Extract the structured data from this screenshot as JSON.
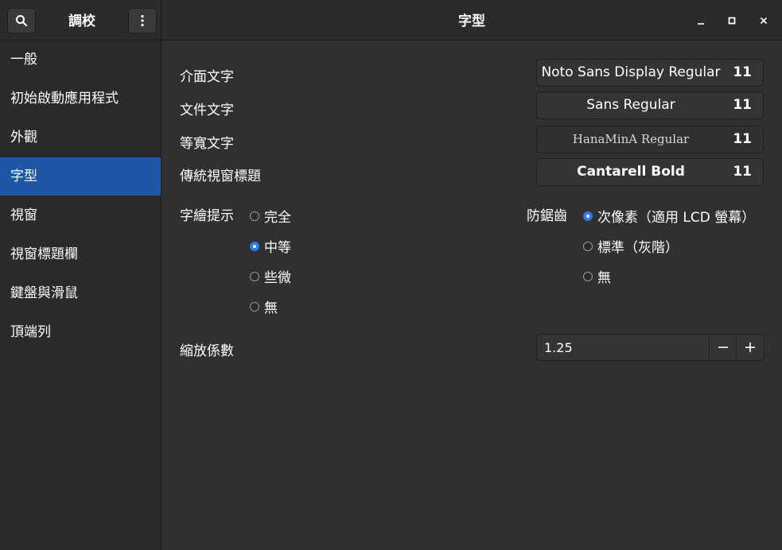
{
  "sidebar_header": {
    "title": "調校"
  },
  "header": {
    "title": "字型"
  },
  "sidebar": {
    "items": [
      {
        "label": "一般"
      },
      {
        "label": "初始啟動應用程式"
      },
      {
        "label": "外觀"
      },
      {
        "label": "字型",
        "active": true
      },
      {
        "label": "視窗"
      },
      {
        "label": "視窗標題欄"
      },
      {
        "label": "鍵盤與滑鼠"
      },
      {
        "label": "頂端列"
      }
    ]
  },
  "fonts": {
    "interface": {
      "label": "介面文字",
      "name": "Noto Sans Display Regular",
      "size": "11"
    },
    "document": {
      "label": "文件文字",
      "name": "Sans Regular",
      "size": "11"
    },
    "monospace": {
      "label": "等寬文字",
      "name": "HanaMinA Regular",
      "size": "11"
    },
    "titlebar": {
      "label": "傳統視窗標題",
      "name": "Cantarell Bold",
      "size": "11"
    }
  },
  "hinting": {
    "label": "字繪提示",
    "options": [
      "完全",
      "中等",
      "些微",
      "無"
    ],
    "selected": "中等"
  },
  "antialiasing": {
    "label": "防鋸齒",
    "options": [
      "次像素（適用 LCD 螢幕）",
      "標準（灰階）",
      "無"
    ],
    "selected": "次像素（適用 LCD 螢幕）"
  },
  "scaling": {
    "label": "縮放係數",
    "value": "1.25"
  },
  "colors": {
    "accent": "#1d57a6",
    "radio_on": "#2f7be6",
    "background": "#303030",
    "sidebar": "#2a2a2a"
  }
}
